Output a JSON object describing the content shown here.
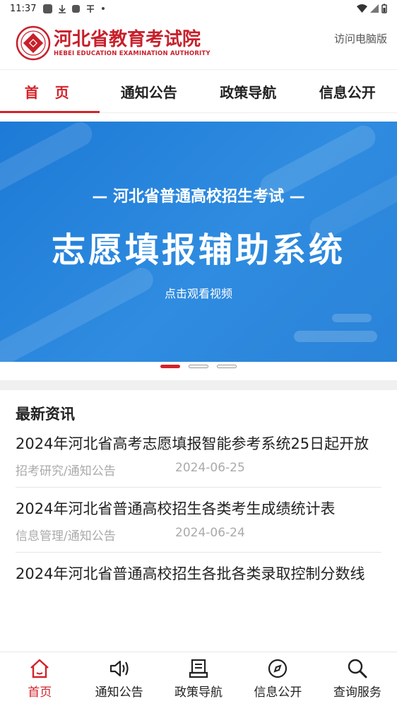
{
  "status_bar": {
    "time": "11:37"
  },
  "header": {
    "title_cn": "河北省教育考试院",
    "title_en": "HEBEI EDUCATION EXAMINATION AUTHORITY",
    "pc_version": "访问电脑版"
  },
  "tabs": [
    {
      "label": "首 页"
    },
    {
      "label": "通知公告"
    },
    {
      "label": "政策导航"
    },
    {
      "label": "信息公开"
    }
  ],
  "banner": {
    "subtitle": "— 河北省普通高校招生考试 —",
    "title": "志愿填报辅助系统",
    "cta": "点击观看视频",
    "active_slide": 1,
    "slide_count": 3
  },
  "news": {
    "section_title": "最新资讯",
    "items": [
      {
        "headline": "2024年河北省高考志愿填报智能参考系统25日起开放",
        "category": "招考研究/通知公告",
        "date": "2024-06-25"
      },
      {
        "headline": "2024年河北省普通高校招生各类考生成绩统计表",
        "category": "信息管理/通知公告",
        "date": "2024-06-24"
      },
      {
        "headline": "2024年河北省普通高校招生各批各类录取控制分数线",
        "category": "",
        "date": ""
      }
    ]
  },
  "bottom_nav": [
    {
      "label": "首页",
      "icon": "home-icon"
    },
    {
      "label": "通知公告",
      "icon": "speaker-icon"
    },
    {
      "label": "政策导航",
      "icon": "document-icon"
    },
    {
      "label": "信息公开",
      "icon": "compass-icon"
    },
    {
      "label": "查询服务",
      "icon": "search-icon"
    }
  ],
  "colors": {
    "accent": "#d2232a",
    "banner_blue": "#2a83d8"
  }
}
